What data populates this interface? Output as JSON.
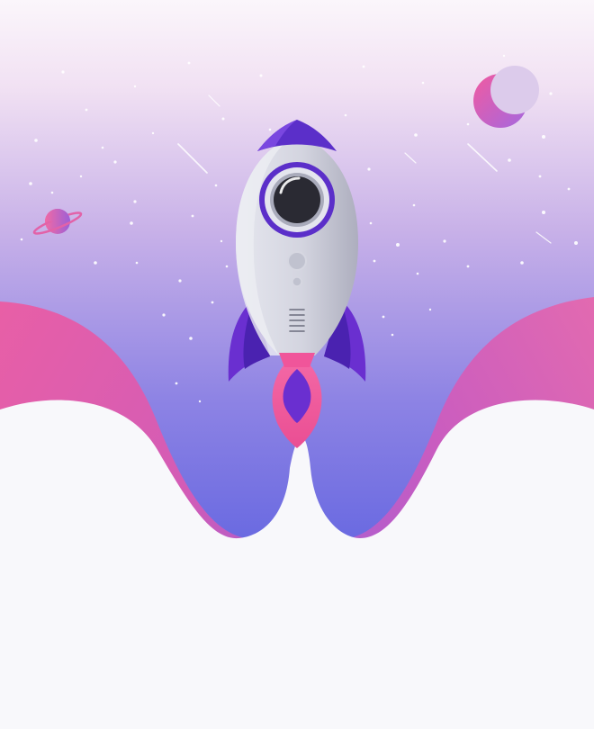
{
  "scene": {
    "subject": "rocket-launch",
    "colors": {
      "sky_top": "#fbf6fb",
      "sky_upper": "#d9b7e8",
      "sky_mid": "#9d8ee5",
      "sky_low": "#5e60e0",
      "wave_pink": "#e85fa6",
      "wave_violet": "#9a5fd6",
      "ground": "#f8f8fb",
      "rocket_body": "#cfd1dd",
      "rocket_body_shade": "#a9abbb",
      "rocket_nose": "#5b2fc9",
      "rocket_fin": "#6a2fd0",
      "porthole_ring": "#5b2fc9",
      "porthole_glass": "#2a2a33",
      "flame_outer": "#f0559a",
      "flame_inner": "#6a2fd0",
      "moon": "#f06aa5",
      "planet": "#f06aa5",
      "stars": "#ffffff"
    },
    "icons": [
      "rocket-icon",
      "moon-icon",
      "planet-icon",
      "star-icon",
      "shooting-star-icon"
    ]
  }
}
